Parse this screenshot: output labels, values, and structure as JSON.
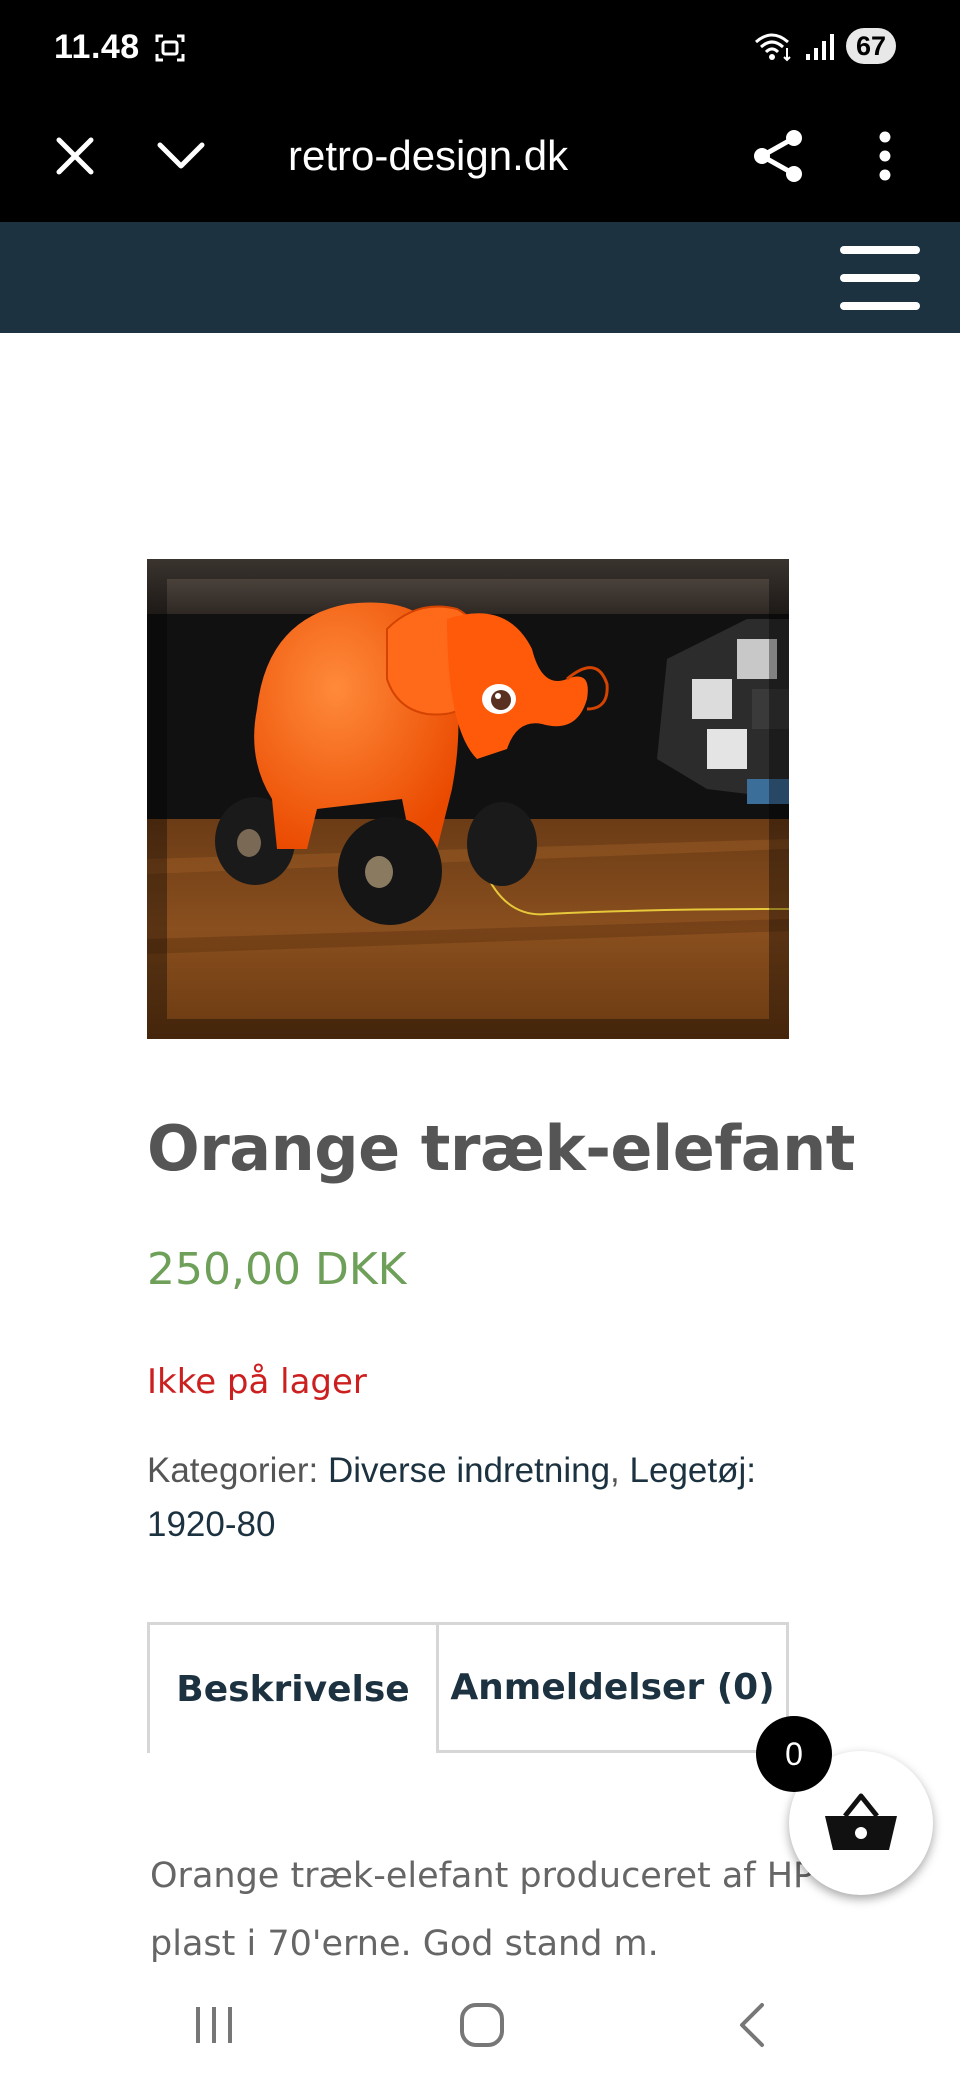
{
  "status_bar": {
    "time": "11.48",
    "battery": "67",
    "icons": [
      "screenshot-icon",
      "wifi-icon",
      "signal-icon",
      "battery-icon"
    ]
  },
  "browser": {
    "url": "retro-design.dk",
    "icons": [
      "close-icon",
      "chevron-down-icon",
      "share-icon",
      "more-vertical-icon"
    ]
  },
  "header": {
    "bg_color": "#1c3240",
    "menu_icon": "hamburger-menu-icon"
  },
  "product": {
    "image_alt_icon": "orange-elephant-toy-photo",
    "title": "Orange træk-elefant",
    "price": "250,00 DKK",
    "stock": "Ikke på lager",
    "categories_label": "Kategorier:",
    "category_1": "Diverse indretning",
    "separator": ",",
    "category_2": "Legetøj: 1920-80"
  },
  "tabs": {
    "description": "Beskrivelse",
    "reviews": "Anmeldelser (0)"
  },
  "description": {
    "line_1": "Orange træk-elefant produceret af HP",
    "line_2": "plast i 70'erne. God stand m."
  },
  "cart": {
    "count": "0",
    "icon": "basket-icon"
  },
  "navbar": {
    "icons": [
      "recent-apps-icon",
      "home-icon",
      "back-icon"
    ]
  },
  "colors": {
    "price": "#6ea05a",
    "stock": "#cc1f1f",
    "title": "#555555",
    "link": "#1c3240"
  }
}
